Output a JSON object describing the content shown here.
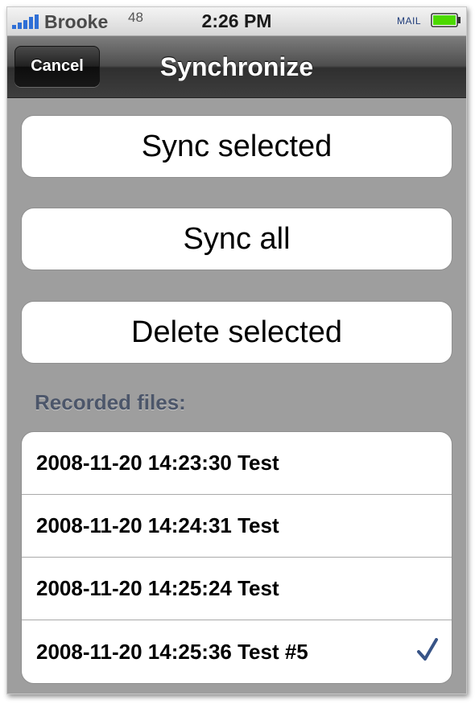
{
  "status_bar": {
    "carrier": "Brooke",
    "carrier_number": "48",
    "time": "2:26 PM",
    "app_indicator": "MAIL",
    "signal_icon": "signal-bars-icon",
    "battery_icon": "battery-icon",
    "battery_color": "#4cd900"
  },
  "nav": {
    "cancel_label": "Cancel",
    "title": "Synchronize"
  },
  "actions": {
    "sync_selected": "Sync selected",
    "sync_all": "Sync all",
    "delete_selected": "Delete selected"
  },
  "files": {
    "header": "Recorded files:",
    "items": [
      {
        "label": "2008-11-20 14:23:30 Test",
        "checked": false
      },
      {
        "label": "2008-11-20 14:24:31 Test",
        "checked": false
      },
      {
        "label": "2008-11-20 14:25:24 Test",
        "checked": false
      },
      {
        "label": "2008-11-20 14:25:36 Test #5",
        "checked": true
      }
    ],
    "check_icon": "checkmark-icon",
    "check_color": "#385487"
  }
}
